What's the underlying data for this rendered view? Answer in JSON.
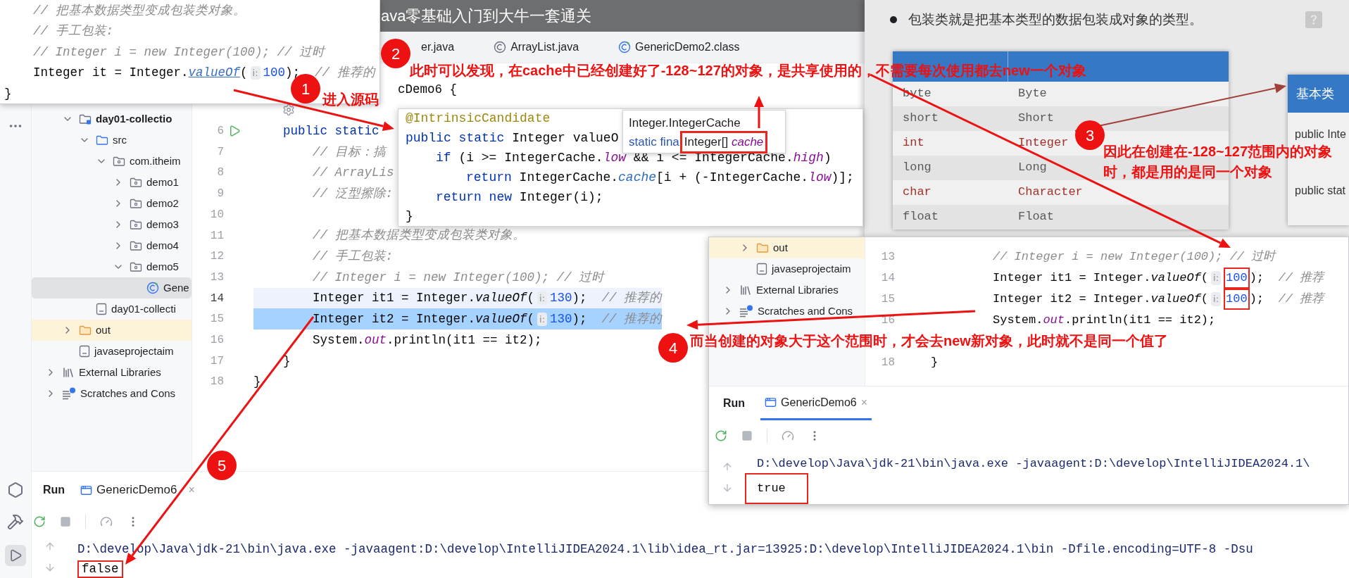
{
  "video_title": "ava零基础入门到大牛一套通关",
  "top_snippet": {
    "lines": [
      [
        {
          "kind": "comment",
          "text": "// 把基本数据类型变成包装类对象。"
        }
      ],
      [
        {
          "kind": "comment",
          "text": "// 手工包装:"
        }
      ],
      [
        {
          "kind": "comment",
          "text": "// Integer i = new Integer(100); // 过时"
        }
      ],
      [
        {
          "kind": "plain",
          "text": "Integer it = Integer."
        },
        {
          "kind": "link",
          "text": "valueOf"
        },
        {
          "kind": "plain",
          "text": "("
        },
        {
          "kind": "hint",
          "text": "i:"
        },
        {
          "kind": "number",
          "text": "100"
        },
        {
          "kind": "plain",
          "text": ");"
        },
        {
          "kind": "comment",
          "text": "  // 推荐的"
        }
      ],
      [
        {
          "kind": "plain",
          "text": "}"
        }
      ]
    ]
  },
  "editor": {
    "tabs": [
      {
        "label": "er.java",
        "kind": "cut"
      },
      {
        "label": "ArrayList.java",
        "kind": "class"
      },
      {
        "label": "GenericDemo2.class",
        "kind": "compiled"
      }
    ],
    "class_line": "cDemo6 {",
    "lines": [
      {
        "number": "6",
        "runnable": true,
        "current": false,
        "selected": false,
        "segments": [
          {
            "kind": "kw",
            "text": "public static"
          }
        ]
      },
      {
        "number": "7",
        "runnable": false,
        "current": false,
        "selected": false,
        "segments": [
          {
            "kind": "comment",
            "text": "// 目标：搞"
          }
        ]
      },
      {
        "number": "8",
        "runnable": false,
        "current": false,
        "selected": false,
        "segments": [
          {
            "kind": "comment",
            "text": "// ArrayLis"
          }
        ]
      },
      {
        "number": "9",
        "runnable": false,
        "current": false,
        "selected": false,
        "segments": [
          {
            "kind": "comment",
            "text": "// 泛型擦除:"
          }
        ]
      },
      {
        "number": "10",
        "runnable": false,
        "current": false,
        "selected": false
      },
      {
        "number": "11",
        "runnable": false,
        "current": false,
        "selected": false,
        "segments": [
          {
            "kind": "comment",
            "text": "// 把基本数据类型变成包装类对象。"
          }
        ]
      },
      {
        "number": "12",
        "runnable": false,
        "current": false,
        "selected": false,
        "segments": [
          {
            "kind": "comment",
            "text": "// 手工包装:"
          }
        ]
      },
      {
        "number": "13",
        "runnable": false,
        "current": false,
        "selected": false,
        "segments": [
          {
            "kind": "comment",
            "text": "// Integer i = new Integer(100); // 过时"
          }
        ]
      },
      {
        "number": "14",
        "runnable": false,
        "current": true,
        "selected": false,
        "segments": [
          {
            "kind": "plain",
            "text": "Integer it1 = Integer."
          },
          {
            "kind": "italic",
            "text": "valueOf"
          },
          {
            "kind": "plain",
            "text": "("
          },
          {
            "kind": "hint",
            "text": "i:"
          },
          {
            "kind": "number",
            "text": "130"
          },
          {
            "kind": "plain",
            "text": ");"
          },
          {
            "kind": "comment",
            "text": "  // 推荐的"
          }
        ]
      },
      {
        "number": "15",
        "runnable": false,
        "current": false,
        "selected": true,
        "segments": [
          {
            "kind": "plain",
            "text": "Integer it2 = Integer."
          },
          {
            "kind": "italic",
            "text": "valueOf"
          },
          {
            "kind": "plain",
            "text": "("
          },
          {
            "kind": "hint",
            "text": "i:"
          },
          {
            "kind": "number",
            "text": "130"
          },
          {
            "kind": "plain",
            "text": ");"
          },
          {
            "kind": "comment",
            "text": "  // 推荐的"
          }
        ]
      },
      {
        "number": "16",
        "runnable": false,
        "current": false,
        "selected": false,
        "segments": [
          {
            "kind": "plain",
            "text": "System."
          },
          {
            "kind": "field",
            "text": "out"
          },
          {
            "kind": "plain",
            "text": ".println(it1 == it2);"
          }
        ]
      },
      {
        "number": "17",
        "runnable": false,
        "current": false,
        "selected": false,
        "segments": [
          {
            "kind": "plain",
            "text": "}"
          }
        ]
      },
      {
        "number": "18",
        "runnable": false,
        "current": false,
        "selected": false,
        "segments": [
          {
            "kind": "plain",
            "text": "}"
          }
        ]
      }
    ]
  },
  "project_tree": {
    "items": [
      {
        "label": "day01-collectio",
        "kind": "module",
        "selected": false,
        "expanded": true,
        "children": [
          {
            "label": "src",
            "kind": "source-folder",
            "selected": false,
            "expanded": true,
            "children": [
              {
                "label": "com.itheim",
                "kind": "package",
                "selected": false,
                "expanded": true,
                "children": [
                  {
                    "label": "demo1",
                    "kind": "package",
                    "selected": false,
                    "expanded": false
                  },
                  {
                    "label": "demo2",
                    "kind": "package",
                    "selected": false,
                    "expanded": false
                  },
                  {
                    "label": "demo3",
                    "kind": "package",
                    "selected": false,
                    "expanded": false
                  },
                  {
                    "label": "demo4",
                    "kind": "package",
                    "selected": false,
                    "expanded": false
                  },
                  {
                    "label": "demo5",
                    "kind": "package",
                    "selected": false,
                    "expanded": true,
                    "children": [
                      {
                        "label": "Gene",
                        "kind": "class",
                        "selected": true
                      }
                    ]
                  }
                ]
              }
            ]
          },
          {
            "label": "day01-collecti",
            "kind": "file",
            "selected": false
          }
        ]
      },
      {
        "label": "out",
        "kind": "excluded-folder",
        "selected": false,
        "expanded": false
      },
      {
        "label": "javaseprojectaim",
        "kind": "file",
        "selected": false
      }
    ],
    "roots": [
      {
        "label": "External Libraries",
        "kind": "libraries",
        "selected": false,
        "expanded": false
      },
      {
        "label": "Scratches and Cons",
        "kind": "scratches",
        "selected": false,
        "expanded": false
      }
    ]
  },
  "run_panel": {
    "title": "Run",
    "tab": "GenericDemo6",
    "close": "×",
    "command": "D:\\develop\\Java\\jdk-21\\bin\\java.exe -javaagent:D:\\develop\\IntelliJIDEA2024.1\\lib\\idea_rt.jar=13925:D:\\develop\\IntelliJIDEA2024.1\\bin -Dfile.encoding=UTF-8 -Dsu",
    "result": "false"
  },
  "slide": {
    "bullet": "包装类就是把基本类型的数据包装成对象的类型。",
    "rows": [
      {
        "primitive": "byte",
        "wrapper": "Byte",
        "color": "#595959"
      },
      {
        "primitive": "short",
        "wrapper": "Short",
        "color": "#595959"
      },
      {
        "primitive": "int",
        "wrapper": "Integer",
        "color": "#a3312b"
      },
      {
        "primitive": "long",
        "wrapper": "Long",
        "color": "#595959"
      },
      {
        "primitive": "char",
        "wrapper": "Character",
        "color": "#a3312b"
      },
      {
        "primitive": "float",
        "wrapper": "Float",
        "color": "#595959"
      }
    ],
    "side_table": {
      "header": "基本类",
      "rows": [
        "public Inte",
        "public stat"
      ]
    }
  },
  "source_popup": {
    "lines": [
      [
        {
          "kind": "annotation",
          "text": "@IntrinsicCandidate"
        }
      ],
      [
        {
          "kind": "kw",
          "text": "public static "
        },
        {
          "kind": "plain",
          "text": "Integer valueO"
        }
      ],
      [
        {
          "kind": "kw",
          "text": "if"
        },
        {
          "kind": "plain",
          "text": " (i >= IntegerCache."
        },
        {
          "kind": "field",
          "text": "low"
        },
        {
          "kind": "plain",
          "text": " && i <= IntegerCache."
        },
        {
          "kind": "field",
          "text": "high"
        },
        {
          "kind": "plain",
          "text": ")"
        }
      ],
      [
        {
          "kind": "kw",
          "text": "return"
        },
        {
          "kind": "plain",
          "text": " IntegerCache."
        },
        {
          "kind": "static-field",
          "text": "cache"
        },
        {
          "kind": "plain",
          "text": "[i + (-IntegerCache."
        },
        {
          "kind": "field",
          "text": "low"
        },
        {
          "kind": "plain",
          "text": ")];"
        }
      ],
      [
        {
          "kind": "kw",
          "text": "return new"
        },
        {
          "kind": "plain",
          "text": " Integer(i);"
        }
      ],
      [
        {
          "kind": "plain",
          "text": "}"
        }
      ]
    ],
    "tooltip": {
      "title": "Integer.IntegerCache",
      "prefix": "static fina",
      "type": "Integer[]",
      "name": "cache"
    }
  },
  "inset": {
    "tree": {
      "items": [
        {
          "label": "out",
          "kind": "excluded-folder",
          "selected": false,
          "expanded": false
        },
        {
          "label": "javaseprojectaim",
          "kind": "file",
          "selected": false
        }
      ],
      "roots": [
        {
          "label": "External Libraries",
          "kind": "libraries",
          "selected": false,
          "expanded": false
        },
        {
          "label": "Scratches and Cons",
          "kind": "scratches",
          "selected": false,
          "expanded": false
        }
      ]
    },
    "lines": [
      {
        "kind": "code",
        "number": "13",
        "segments": [
          {
            "kind": "comment",
            "text": "// Integer i = new Integer(100); // 过时"
          }
        ]
      },
      {
        "kind": "code",
        "number": "14",
        "segments": [
          {
            "kind": "plain",
            "text": "Integer it1 = Integer."
          },
          {
            "kind": "italic",
            "text": "valueOf"
          },
          {
            "kind": "plain",
            "text": "("
          },
          {
            "kind": "hint",
            "text": "i:"
          },
          {
            "kind": "boxed-number",
            "text": "100"
          },
          {
            "kind": "plain",
            "text": ");"
          },
          {
            "kind": "comment",
            "text": "  // 推荐"
          }
        ]
      },
      {
        "kind": "code",
        "number": "15",
        "segments": [
          {
            "kind": "plain",
            "text": "Integer it2 = Integer."
          },
          {
            "kind": "italic",
            "text": "valueOf"
          },
          {
            "kind": "plain",
            "text": "("
          },
          {
            "kind": "hint",
            "text": "i:"
          },
          {
            "kind": "boxed-number",
            "text": "100"
          },
          {
            "kind": "plain",
            "text": ");"
          },
          {
            "kind": "comment",
            "text": "  // 推荐"
          }
        ]
      },
      {
        "kind": "code",
        "number": "16",
        "segments": [
          {
            "kind": "plain",
            "text": "System."
          },
          {
            "kind": "field",
            "text": "out"
          },
          {
            "kind": "plain",
            "text": ".println(it1 == it2);"
          }
        ]
      },
      {
        "kind": "covered"
      },
      {
        "kind": "code",
        "number": "18",
        "segments": [
          {
            "kind": "plain",
            "text": "}"
          }
        ]
      }
    ],
    "run_panel": {
      "title": "Run",
      "tab": "GenericDemo6",
      "close": "×",
      "command": "D:\\develop\\Java\\jdk-21\\bin\\java.exe -javaagent:D:\\develop\\IntelliJIDEA2024.1\\",
      "result": "true"
    }
  },
  "annotations": [
    {
      "number": "1",
      "text": "进入源码"
    },
    {
      "number": "2",
      "text": "此时可以发现，在cache中已经创建好了-128~127的对象，是共享使用的，不需要每次使用都去new一个对象"
    },
    {
      "number": "3",
      "text": "因此在创建在-128~127范围内的对象时，都是用的是同一个对象"
    },
    {
      "number": "4",
      "text": "而当创建的对象大于这个范围时，才会去new新对象，此时就不是同一个值了"
    },
    {
      "number": "5"
    }
  ]
}
